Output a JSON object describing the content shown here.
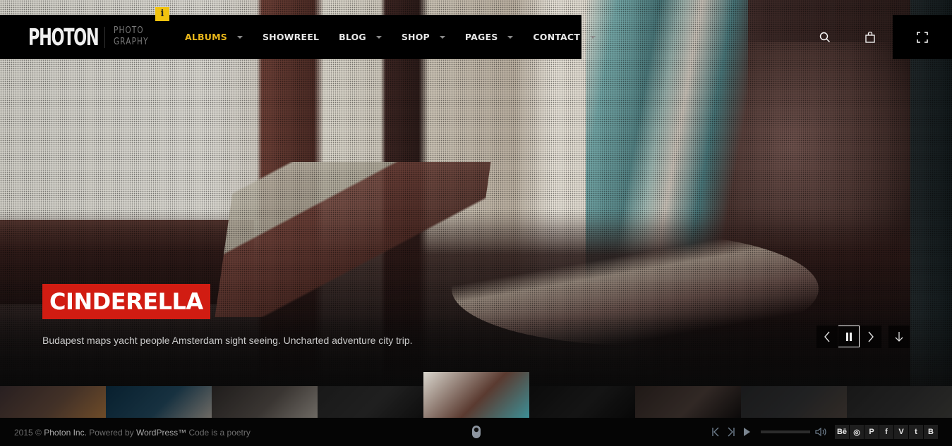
{
  "brand": {
    "name": "PHOTON",
    "tagline_line1": "PHOTO",
    "tagline_line2": "GRAPHY",
    "info_badge": "i"
  },
  "nav": {
    "items": [
      {
        "label": "ALBUMS",
        "active": true,
        "has_dropdown": true
      },
      {
        "label": "SHOWREEL",
        "active": false,
        "has_dropdown": false
      },
      {
        "label": "BLOG",
        "active": false,
        "has_dropdown": true
      },
      {
        "label": "SHOP",
        "active": false,
        "has_dropdown": true
      },
      {
        "label": "PAGES",
        "active": false,
        "has_dropdown": true
      },
      {
        "label": "CONTACT",
        "active": false,
        "has_dropdown": true
      }
    ],
    "icons": {
      "search": "search-icon",
      "cart": "shopping-bag-icon",
      "fullscreen": "fullscreen-icon"
    }
  },
  "slide": {
    "title": "CINDERELLA",
    "description": "Budapest maps yacht people Amsterdam sight seeing. Uncharted adventure city trip.",
    "controls": {
      "prev": "chevron-left-icon",
      "pause": "pause-icon",
      "next": "chevron-right-icon",
      "scroll_down": "arrow-down-icon"
    }
  },
  "thumbnails": {
    "count": 9,
    "active_index": 4,
    "items": [
      {
        "subject": "sunset sky",
        "colors": [
          "#4a3a3c",
          "#7a5a48",
          "#c98a4a"
        ]
      },
      {
        "subject": "ferris wheel",
        "colors": [
          "#0f3a55",
          "#2a5a75",
          "#c9c2b8"
        ]
      },
      {
        "subject": "dining chairs",
        "colors": [
          "#3a3533",
          "#6a625c",
          "#c8c0b5"
        ]
      },
      {
        "subject": "rooftop silhouette",
        "colors": [
          "#2e2e2e",
          "#3a3a3a",
          "#1a1a1a"
        ]
      },
      {
        "subject": "woman reading by window",
        "colors": [
          "#d9d6cd",
          "#5a3a30",
          "#3d8f96"
        ]
      },
      {
        "subject": "dark architecture",
        "colors": [
          "#151515",
          "#262626",
          "#0e0e0e"
        ]
      },
      {
        "subject": "woman in lace",
        "colors": [
          "#3a2e2a",
          "#5a4a44",
          "#161212"
        ]
      },
      {
        "subject": "photographer",
        "colors": [
          "#2f3032",
          "#3c3d3f",
          "#5a4e46"
        ]
      },
      {
        "subject": "coastal town",
        "colors": [
          "#2c2c2c",
          "#3a3a3a",
          "#4a4a46"
        ]
      }
    ]
  },
  "footer": {
    "year": "2015 ©",
    "company": "Photon Inc.",
    "powered_by": "Powered by",
    "platform": "WordPress™",
    "tagline": "Code is a poetry",
    "scroll_icon": "mouse-icon",
    "player": {
      "prev": "skip-back-icon",
      "next": "skip-forward-icon",
      "play": "play-icon",
      "volume_icon": "volume-icon",
      "volume_level": 0
    },
    "socials": [
      {
        "name": "behance",
        "glyph": "Bē"
      },
      {
        "name": "dribbble",
        "glyph": "◎"
      },
      {
        "name": "pinterest",
        "glyph": "P"
      },
      {
        "name": "facebook",
        "glyph": "f"
      },
      {
        "name": "vimeo",
        "glyph": "V"
      },
      {
        "name": "twitter",
        "glyph": "t"
      },
      {
        "name": "blogger",
        "glyph": "B"
      }
    ]
  },
  "colors": {
    "accent_yellow": "#eab81b",
    "title_red": "#d11c12",
    "header_black": "#000000",
    "badge_yellow": "#f0c20e"
  }
}
